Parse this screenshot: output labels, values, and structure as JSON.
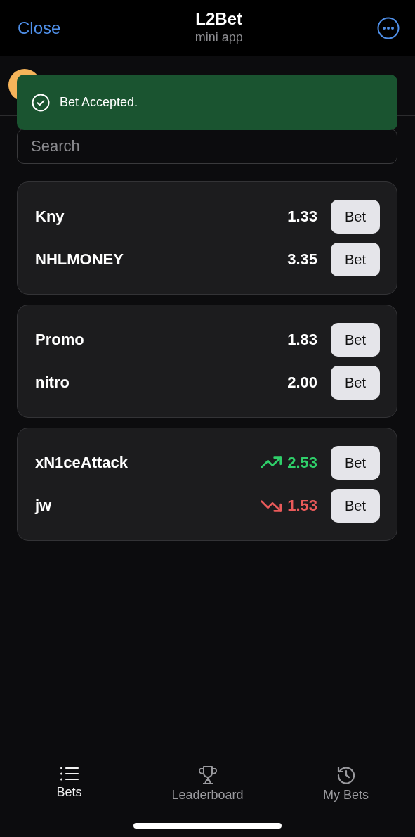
{
  "header": {
    "close": "Close",
    "title": "L2Bet",
    "subtitle": "mini app"
  },
  "toast": {
    "message": "Bet Accepted."
  },
  "search": {
    "placeholder": "Search"
  },
  "matches": [
    {
      "rows": [
        {
          "name": "Kny",
          "odds": "1.33",
          "kind": "steady",
          "button": "Bet"
        },
        {
          "name": "NHLMONEY",
          "odds": "3.35",
          "kind": "steady",
          "button": "Bet"
        }
      ]
    },
    {
      "rows": [
        {
          "name": "Promo",
          "odds": "1.83",
          "kind": "steady",
          "button": "Bet"
        },
        {
          "name": "nitro",
          "odds": "2.00",
          "kind": "steady",
          "button": "Bet"
        }
      ]
    },
    {
      "rows": [
        {
          "name": "xN1ceAttack",
          "odds": "2.53",
          "kind": "rising",
          "button": "Bet"
        },
        {
          "name": "jw",
          "odds": "1.53",
          "kind": "falling",
          "button": "Bet"
        }
      ]
    }
  ],
  "tabs": [
    {
      "label": "Bets",
      "selected": true
    },
    {
      "label": "Leaderboard",
      "selected": false
    },
    {
      "label": "My Bets",
      "selected": false
    }
  ]
}
